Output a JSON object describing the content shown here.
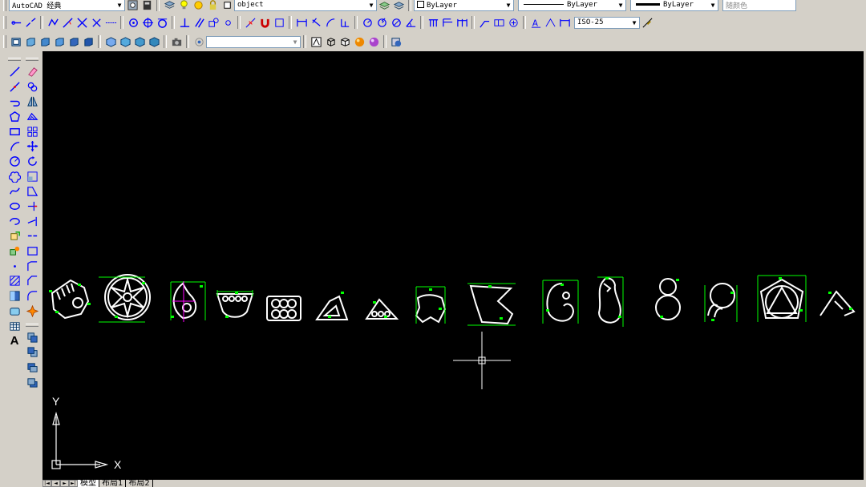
{
  "toolbar_top": {
    "workspace": "AutoCAD 经典",
    "layer": "object",
    "color": "ByLayer",
    "linetype": "ByLayer",
    "lineweight": "ByLayer",
    "plotstyle": "随颜色"
  },
  "toolbar_dim": {
    "dimstyle": "ISO-25"
  },
  "toolbar_3d": {
    "visual_style": ""
  },
  "draw_toolbar": {
    "text_tool": "A"
  },
  "ucs": {
    "y_label": "Y",
    "x_label": "X"
  },
  "layout_tabs": {
    "model": "模型",
    "layout1": "布局1",
    "layout2": "布局2"
  },
  "colors": {
    "canvas_bg": "#000000",
    "geometry": "#ffffff",
    "dimensions": "#00ff00",
    "accent": "#ff00ff",
    "toolbar_bg": "#d4d0c8"
  }
}
